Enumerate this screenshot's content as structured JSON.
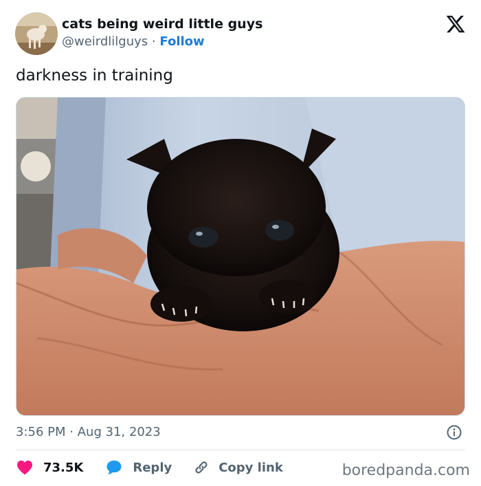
{
  "author": {
    "display_name": "cats being weird little guys",
    "handle": "@weirdlilguys",
    "separator": "·",
    "follow_label": "Follow"
  },
  "tweet": {
    "text": "darkness in training",
    "time": "3:56 PM",
    "dot": "·",
    "date": "Aug 31, 2023"
  },
  "actions": {
    "likes": "73.5K",
    "reply_label": "Reply",
    "copy_label": "Copy link"
  },
  "watermark": "boredpanda.com",
  "colors": {
    "like": "#f91880",
    "reply": "#1d9bf0",
    "follow": "#1d7bd6",
    "muted": "#536471"
  },
  "icons": {
    "platform_logo": "x-logo-icon",
    "like": "heart-icon",
    "reply": "speech-bubble-icon",
    "copy": "link-icon",
    "info": "info-icon"
  }
}
